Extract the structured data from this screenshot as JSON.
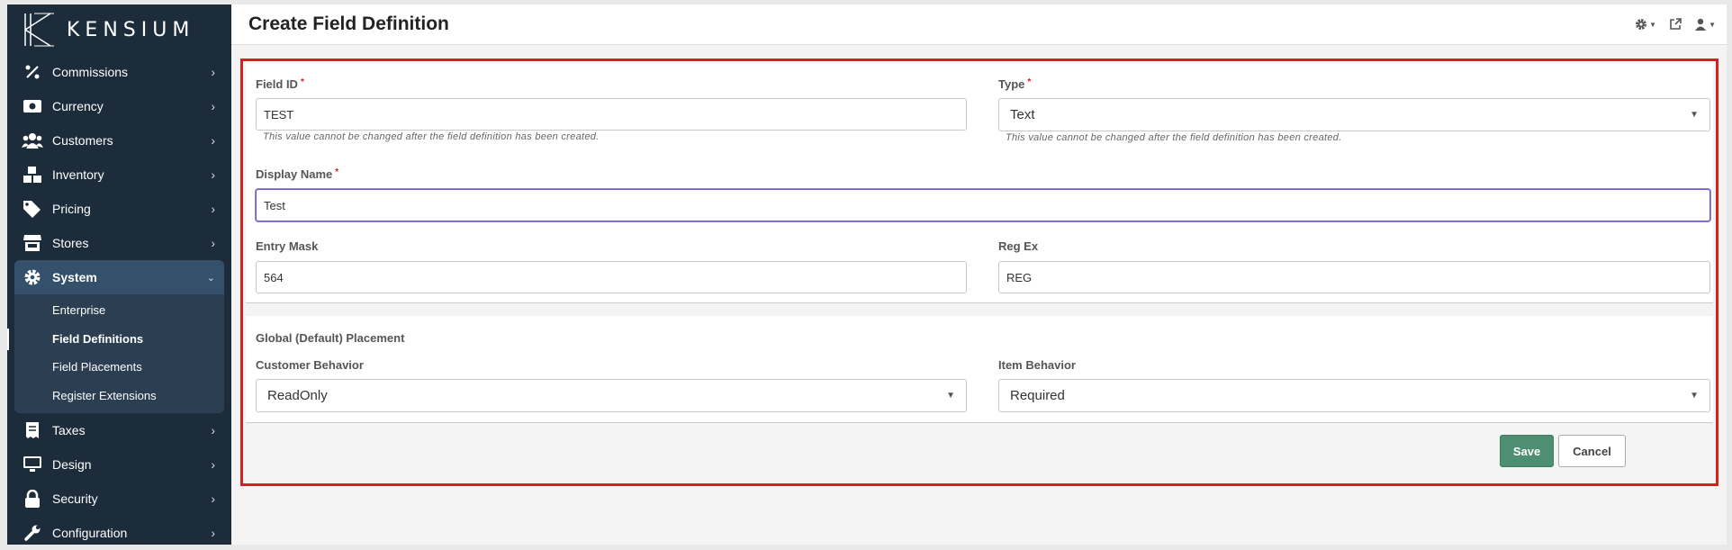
{
  "brand": {
    "name": "KENSIUM"
  },
  "sidebar": {
    "items": [
      {
        "label": "Commissions",
        "icon": "percent-icon"
      },
      {
        "label": "Currency",
        "icon": "money-icon"
      },
      {
        "label": "Customers",
        "icon": "users-icon"
      },
      {
        "label": "Inventory",
        "icon": "boxes-icon"
      },
      {
        "label": "Pricing",
        "icon": "tags-icon"
      },
      {
        "label": "Stores",
        "icon": "store-icon"
      },
      {
        "label": "System",
        "icon": "gear-icon",
        "expanded": true
      },
      {
        "label": "Taxes",
        "icon": "receipt-icon"
      },
      {
        "label": "Design",
        "icon": "monitor-icon"
      },
      {
        "label": "Security",
        "icon": "lock-icon"
      },
      {
        "label": "Configuration",
        "icon": "wrench-icon"
      }
    ],
    "system_subitems": [
      "Enterprise",
      "Field Definitions",
      "Field Placements",
      "Register Extensions"
    ]
  },
  "header": {
    "title": "Create Field Definition"
  },
  "form": {
    "field_id": {
      "label": "Field ID",
      "value": "TEST",
      "hint": "This value cannot be changed after the field definition has been created."
    },
    "type": {
      "label": "Type",
      "value": "Text",
      "hint": "This value cannot be changed after the field definition has been created."
    },
    "display_name": {
      "label": "Display Name",
      "value": "Test"
    },
    "entry_mask": {
      "label": "Entry Mask",
      "value": "564"
    },
    "reg_ex": {
      "label": "Reg Ex",
      "value": "REG"
    },
    "required_marker": "*"
  },
  "placement": {
    "title": "Global (Default) Placement",
    "customer_behavior": {
      "label": "Customer Behavior",
      "value": "ReadOnly"
    },
    "item_behavior": {
      "label": "Item Behavior",
      "value": "Required"
    }
  },
  "actions": {
    "save": "Save",
    "cancel": "Cancel"
  },
  "colors": {
    "sidebar": "#1c2c3b",
    "accent": "#4e8f72",
    "highlight": "#d62020"
  }
}
